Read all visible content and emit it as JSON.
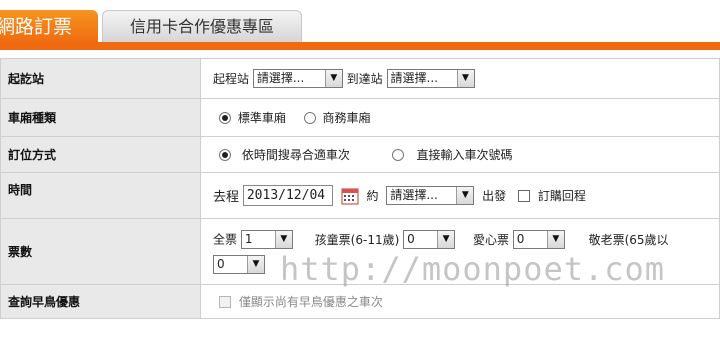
{
  "tabs": {
    "active_label": "網路訂票",
    "inactive_label": "信用卡合作優惠專區"
  },
  "rows": {
    "station": {
      "label": "起訖站",
      "from_label": "起程站",
      "from_value": "請選擇...",
      "to_label": "到達站",
      "to_value": "請選擇..."
    },
    "car_type": {
      "label": "車廂種類",
      "option_standard": "標準車廂",
      "option_business": "商務車廂",
      "selected": "標準車廂"
    },
    "booking_method": {
      "label": "訂位方式",
      "option_search": "依時間搜尋合適車次",
      "option_direct": "直接輸入車次號碼",
      "selected": "依時間搜尋合適車次"
    },
    "time": {
      "label": "時間",
      "outbound_label": "去程",
      "date_value": "2013/12/04",
      "about_label": "約",
      "time_value": "請選擇...",
      "depart_label": "出發",
      "return_label": "訂購回程"
    },
    "tickets": {
      "label": "票數",
      "adult_label": "全票",
      "adult_value": "1",
      "child_label": "孩童票(6-11歲)",
      "child_value": "0",
      "disabled_label": "愛心票",
      "disabled_value": "0",
      "senior_label": "敬老票(65歲以",
      "extra_value": "0"
    },
    "early_bird": {
      "label": "查詢早鳥優惠",
      "checkbox_label": "僅顯示尚有早鳥優惠之車次"
    }
  },
  "watermark": "http://moonpoet.com"
}
